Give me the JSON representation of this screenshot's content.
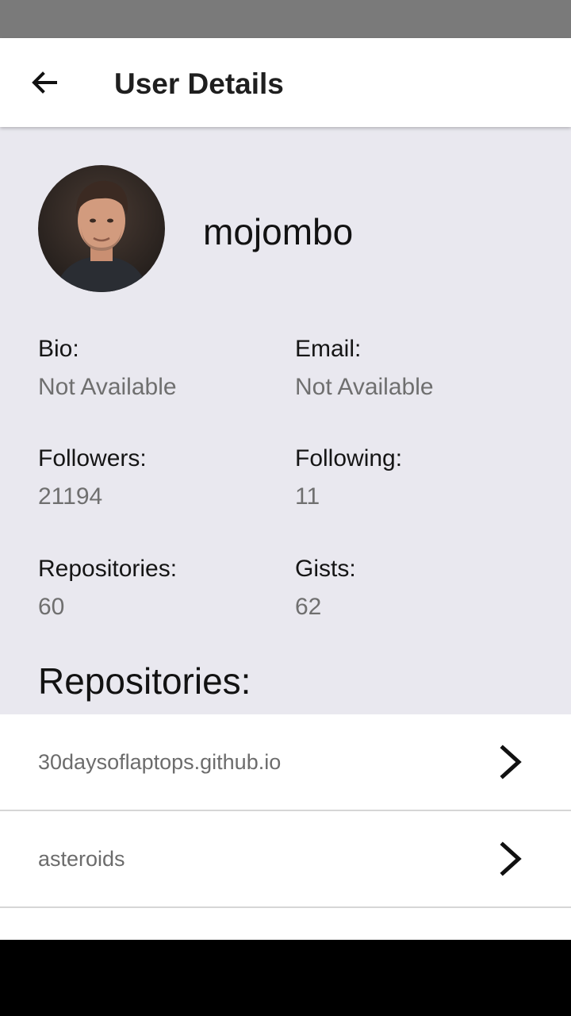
{
  "app_bar": {
    "title": "User Details",
    "back_icon": "arrow-back-icon"
  },
  "user": {
    "username": "mojombo",
    "avatar_icon": "user-avatar"
  },
  "details": {
    "bio_label": "Bio:",
    "bio_value": "Not Available",
    "email_label": "Email:",
    "email_value": "Not Available",
    "followers_label": "Followers:",
    "followers_value": "21194",
    "following_label": "Following:",
    "following_value": "11",
    "repositories_label": "Repositories:",
    "repositories_value": "60",
    "gists_label": "Gists:",
    "gists_value": "62"
  },
  "repositories_section": {
    "title": "Repositories:",
    "items": [
      {
        "name": "30daysoflaptops.github.io",
        "icon": "chevron-right-icon"
      },
      {
        "name": "asteroids",
        "icon": "chevron-right-icon"
      }
    ]
  },
  "colors": {
    "background": "#e9e8ef",
    "status_bar": "#7a7a7a",
    "app_bar": "#ffffff",
    "nav_bar": "#000000"
  }
}
